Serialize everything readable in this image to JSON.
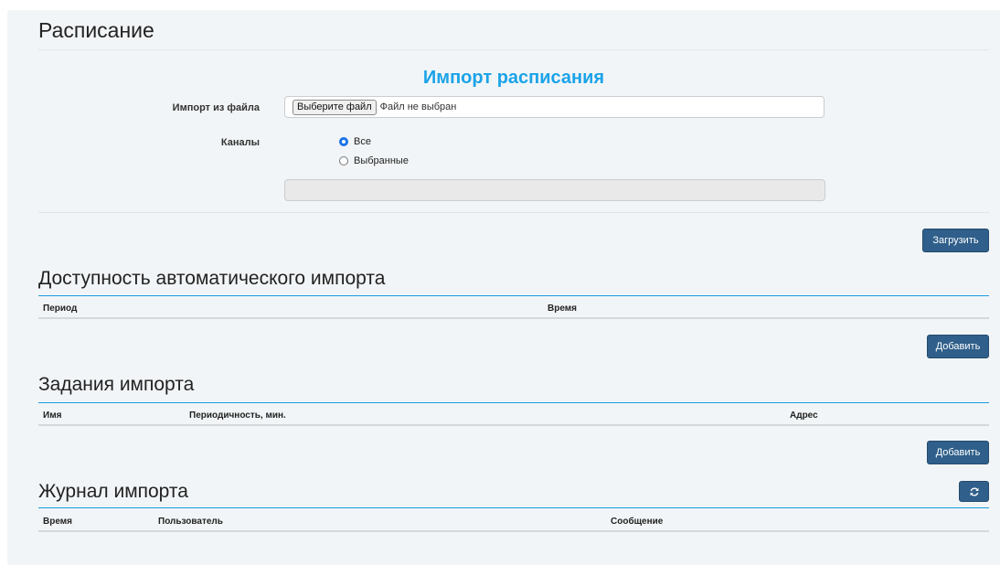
{
  "page": {
    "title": "Расписание",
    "import_heading": "Импорт расписания"
  },
  "import_form": {
    "file_label": "Импорт из файла",
    "file_button": "Выберите файл",
    "file_status": "Файл не выбран",
    "channels_label": "Каналы",
    "channel_options": [
      {
        "label": "Все",
        "checked": true
      },
      {
        "label": "Выбранные",
        "checked": false
      }
    ],
    "upload_button": "Загрузить"
  },
  "auto_import": {
    "title": "Доступность автоматического импорта",
    "columns": [
      "Период",
      "Время"
    ],
    "add_button": "Добавить"
  },
  "import_tasks": {
    "title": "Задания импорта",
    "columns": [
      "Имя",
      "Периодичность, мин.",
      "Адрес"
    ],
    "add_button": "Добавить"
  },
  "import_log": {
    "title": "Журнал импорта",
    "columns": [
      "Время",
      "Пользователь",
      "Сообщение"
    ],
    "refresh_icon": "refresh-icon"
  },
  "colors": {
    "accent": "#1aa3e8",
    "button": "#2f5f8a",
    "panel_bg": "#f2f5f7"
  }
}
